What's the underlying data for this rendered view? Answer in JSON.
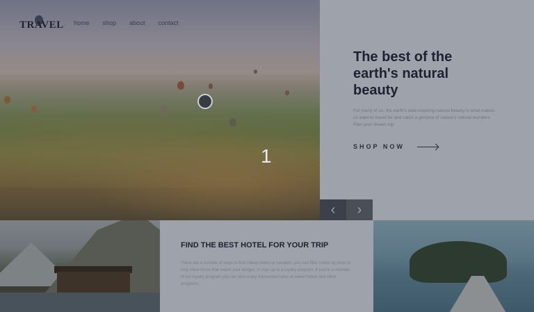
{
  "header": {
    "logo": "TRAVEL",
    "nav": [
      "home",
      "shop",
      "about",
      "contact"
    ]
  },
  "hero": {
    "slide_number": "1"
  },
  "panel": {
    "title": "The best of the earth's natural beauty",
    "body": "For many of us, the earth's awe-inspiring natural beauty is what makes us want to travel far and catch a glimpse of nature's natural wonders. Plan your dream trip",
    "cta": "SHOP NOW"
  },
  "slider": {
    "prev": "‹",
    "next": "›"
  },
  "hotels": {
    "title": "FIND THE BEST HOTEL FOR YOUR TRIP",
    "body": "There are a number of ways to find cheap hotels or vacation, you can filter hotels by price to only show those that match your budget, or sign up to a loyalty program. If you're a member of our loyalty program you can also enjoy discounted rates at select hotels and other programs."
  },
  "colors": {
    "overlay": "#9ea2aa",
    "heading": "#1d2233",
    "muted_text": "#71757f",
    "arrow_button_dark": "#3c404a"
  }
}
